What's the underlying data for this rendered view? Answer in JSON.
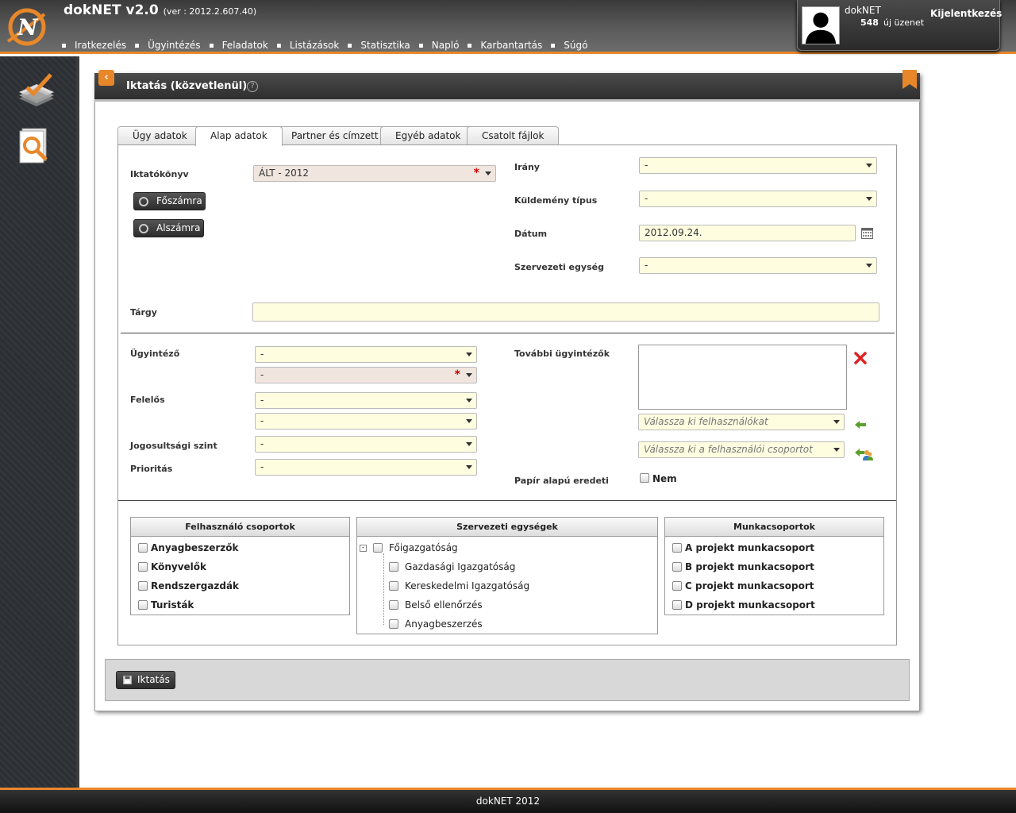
{
  "app": {
    "name": "dokNET v2.0",
    "version": "(ver : 2012.2.607.40)"
  },
  "menu": [
    "Iratkezelés",
    "Ügyintézés",
    "Feladatok",
    "Listázások",
    "Statisztika",
    "Napló",
    "Karbantartás",
    "Súgó"
  ],
  "user": {
    "name": "dokNET",
    "msg_count": "548",
    "msg_label": "új üzenet",
    "logout": "Kijelentkezés"
  },
  "panel": {
    "title": "Iktatás (közvetlenül)"
  },
  "tabs": [
    "Ügy adatok",
    "Alap adatok",
    "Partner és címzett",
    "Egyéb adatok",
    "Csatolt fájlok"
  ],
  "active_tab": "Alap adatok",
  "form": {
    "iktatokonyv_label": "Iktatókönyv",
    "iktatokonyv_value": "ÁLT - 2012",
    "foszamra": "Főszámra",
    "alszamra": "Alszámra",
    "irany_label": "Irány",
    "irany_value": "-",
    "kuldemeny_label": "Küldemény típus",
    "kuldemeny_value": "-",
    "datum_label": "Dátum",
    "datum_value": "2012.09.24.",
    "szerv_label": "Szervezeti egység",
    "szerv_value": "-",
    "targy_label": "Tárgy",
    "targy_value": "",
    "ugyintezo_label": "Ügyintéző",
    "ugyintezo_value1": "-",
    "ugyintezo_value2": "-",
    "felelos_label": "Felelős",
    "felelos_value1": "-",
    "felelos_value2": "-",
    "jog_label": "Jogosultsági szint",
    "jog_value": "-",
    "prior_label": "Prioritás",
    "prior_value": "-",
    "tovabbi_label": "További ügyintézők",
    "users_placeholder": "Válassza ki felhasználókat",
    "groups_placeholder": "Válassza ki a felhasználói csoportot",
    "papir_label": "Papír alapú eredeti",
    "papir_value": "Nem"
  },
  "groups": {
    "title": "Felhasználó csoportok",
    "items": [
      "Anyagbeszerzők",
      "Könyvelők",
      "Rendszergazdák",
      "Turisták"
    ]
  },
  "org": {
    "title": "Szervezeti egységek",
    "root": "Főigazgatóság",
    "children": [
      "Gazdasági Igazgatóság",
      "Kereskedelmi Igazgatóság",
      "Belső ellenőrzés",
      "Anyagbeszerzés"
    ]
  },
  "workgroups": {
    "title": "Munkacsoportok",
    "items": [
      "A projekt munkacsoport",
      "B projekt munkacsoport",
      "C projekt munkacsoport",
      "D projekt munkacsoport"
    ]
  },
  "actions": {
    "iktatas": "Iktatás"
  },
  "footer": "dokNET 2012",
  "colors": {
    "accent": "#e8882a",
    "field_bg": "#fffde0",
    "required_bg": "#f1e6df"
  }
}
